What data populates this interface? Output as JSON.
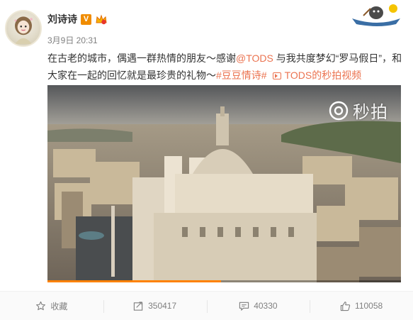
{
  "post": {
    "username": "刘诗诗",
    "verified_badge": "V",
    "timestamp": "3月9日 20:31",
    "text": {
      "part1": "在古老的城市，偶遇一群热情的朋友～感谢",
      "mention": "@TODS",
      "part2": " 与我共度梦幻“罗马假日”，和大家在一起的回忆就是最珍贵的礼物～",
      "hashtag": "#豆豆情诗#",
      "video_link": "TODS的秒拍视频"
    },
    "video": {
      "watermark": "秒拍",
      "progress_fraction": 0.49
    }
  },
  "actions": {
    "favorite": {
      "label": "收藏",
      "icon": "star-icon"
    },
    "repost": {
      "count": "350417",
      "icon": "share-icon"
    },
    "comment": {
      "count": "40330",
      "icon": "comment-icon"
    },
    "like": {
      "count": "110058",
      "icon": "thumbs-up-icon"
    }
  },
  "colors": {
    "link": "#eb7350",
    "text": "#333333",
    "meta": "#808080",
    "verified": "#f08c00",
    "progress": "#ff8200"
  }
}
